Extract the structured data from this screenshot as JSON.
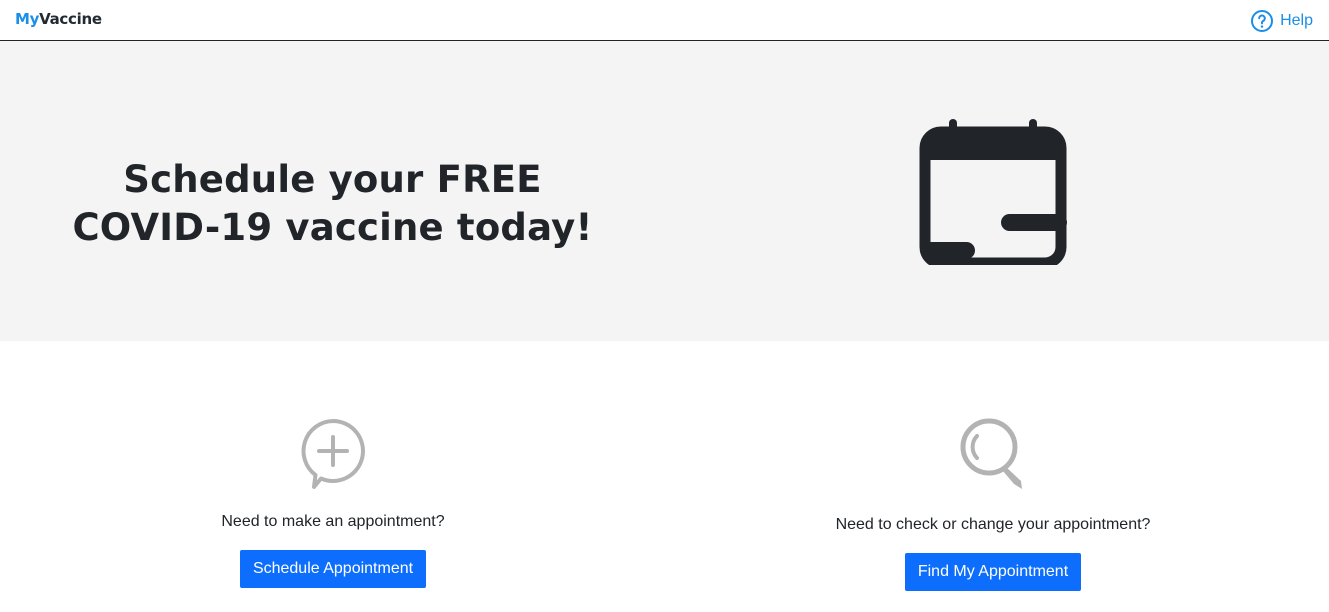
{
  "header": {
    "logo_my": "My",
    "logo_vaccine": "Vaccine",
    "help_label": "Help",
    "help_icon": "question-circle-icon"
  },
  "hero": {
    "title_line1": "Schedule your FREE",
    "title_line2": "COVID-19 vaccine today!",
    "icon": "calendar-icon"
  },
  "actions": {
    "make": {
      "icon": "chat-plus-icon",
      "question": "Need to make an appointment?",
      "button_label": "Schedule Appointment"
    },
    "find": {
      "icon": "magnifier-icon",
      "question": "Need to check or change your appointment?",
      "button_label": "Find My Appointment"
    }
  },
  "colors": {
    "brand_blue": "#1a8ee8",
    "button_blue": "#0d6efd",
    "hero_bg": "#f4f4f4",
    "dark_text": "#212529",
    "icon_gray": "#b3b3b3"
  }
}
